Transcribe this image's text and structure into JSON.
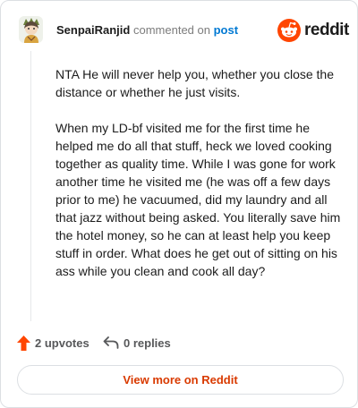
{
  "comment": {
    "username": "SenpaiRanjid",
    "action_text": "commented on",
    "post_link": "post",
    "paragraphs": [
      "NTA He will never help you, whether you close the distance or whether he just visits.",
      "When my LD-bf visited me for the first time he helped me do all that stuff, heck we loved cooking together as quality time. While I was gone for work another time he visited me (he was off a few days prior to me) he vacuumed, did my laundry and all that jazz without being asked. You literally save him the hotel money, so he can at least help you keep stuff in order. What does he get out of sitting on his ass while you clean and cook all day?"
    ],
    "upvotes": "2 upvotes",
    "replies": "0 replies"
  },
  "brand": {
    "wordmark": "reddit",
    "icon": "reddit-snoo-icon",
    "color": "#ff4500"
  },
  "footer": {
    "view_more": "View more on Reddit"
  },
  "colors": {
    "upvote": "#ff4500",
    "link": "#0079d3",
    "view_more": "#d93a00"
  }
}
